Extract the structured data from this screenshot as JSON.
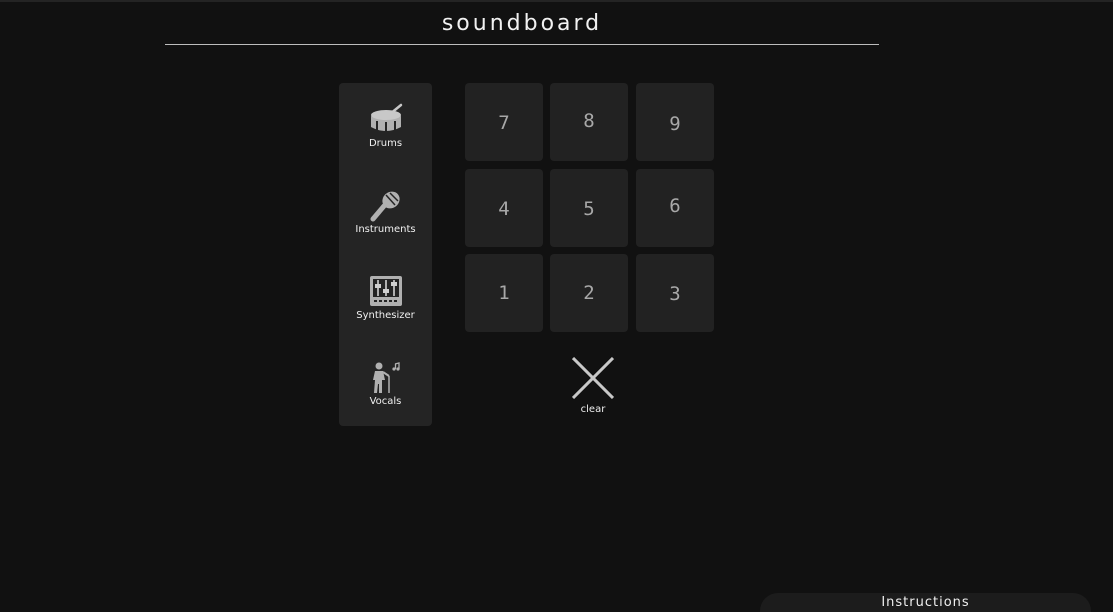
{
  "header": {
    "title": "soundboard"
  },
  "sidebar": {
    "items": [
      {
        "label": "Drums",
        "icon": "drum-icon"
      },
      {
        "label": "Instruments",
        "icon": "maracas-icon"
      },
      {
        "label": "Synthesizer",
        "icon": "synthesizer-icon"
      },
      {
        "label": "Vocals",
        "icon": "singer-icon"
      }
    ]
  },
  "pads": {
    "rows": [
      [
        "7",
        "8",
        "9"
      ],
      [
        "4",
        "5",
        "6"
      ],
      [
        "1",
        "2",
        "3"
      ]
    ]
  },
  "clear": {
    "label": "clear",
    "icon": "close-icon"
  },
  "instructions": {
    "label": "Instructions"
  },
  "colors": {
    "background": "#111111",
    "panel": "#242424",
    "pad": "#222222",
    "pad_text": "#a8a8a8",
    "icon": "#b0b0b0"
  }
}
